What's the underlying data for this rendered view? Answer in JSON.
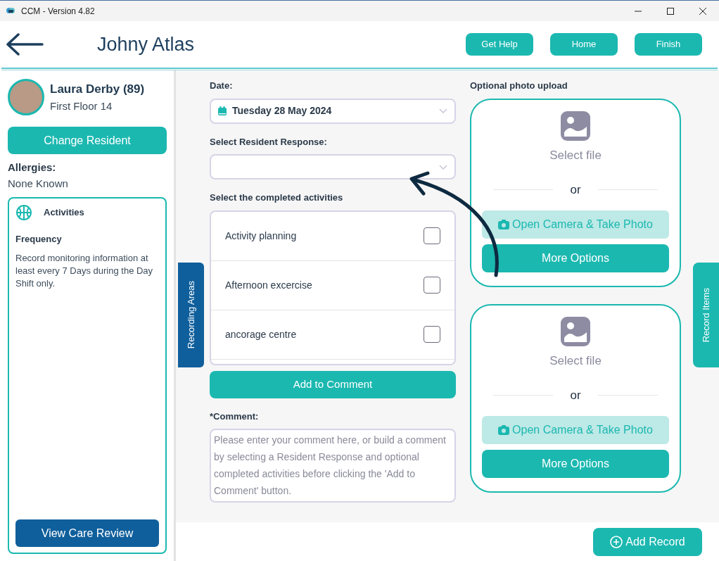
{
  "window": {
    "title": "CCM - Version 4.82"
  },
  "header": {
    "title": "Johny Atlas",
    "buttons": [
      "Get Help",
      "Home",
      "Finish"
    ]
  },
  "resident": {
    "name": "Laura Derby (89)",
    "location": "First Floor 14",
    "change_button": "Change Resident",
    "allergies_label": "Allergies:",
    "allergies": "None Known"
  },
  "care_plan": {
    "title": "Activities",
    "frequency_label": "Frequency",
    "frequency": "Record monitoring information at least every 7 Days during the Day Shift only.",
    "button": "View Care Review"
  },
  "side_tabs": [
    {
      "label": "Recording Areas",
      "color": "#0f5f9c"
    },
    {
      "label": "Record Items",
      "color": "#1bb8b0"
    }
  ],
  "form": {
    "date_label": "Date:",
    "date": "Tuesday 28 May 2024",
    "response_label": "Select Resident Response:",
    "activities_label": "Select the completed activities",
    "activities": [
      {
        "label": "Activity planning",
        "checked": false
      },
      {
        "label": "Afternoon excercise",
        "checked": false
      },
      {
        "label": "ancorage centre",
        "checked": false
      }
    ],
    "add_button": "Add to Comment",
    "comment_label": "*Comment:",
    "comment_placeholder": "Please enter your comment here, or build a comment by selecting a Resident Response and optional completed activities before clicking the 'Add to Comment' button."
  },
  "photo_upload": {
    "label": "Optional photo upload",
    "panels": [
      {
        "select_file": "Select file",
        "separator": "or",
        "camera_button": "Open Camera & Take Photo",
        "more_button": "More Options"
      },
      {
        "select_file": "Select file",
        "separator": "or",
        "camera_button": "Open Camera & Take Photo",
        "more_button": "More Options"
      }
    ]
  },
  "footer": {
    "add_record": "Add Record"
  }
}
